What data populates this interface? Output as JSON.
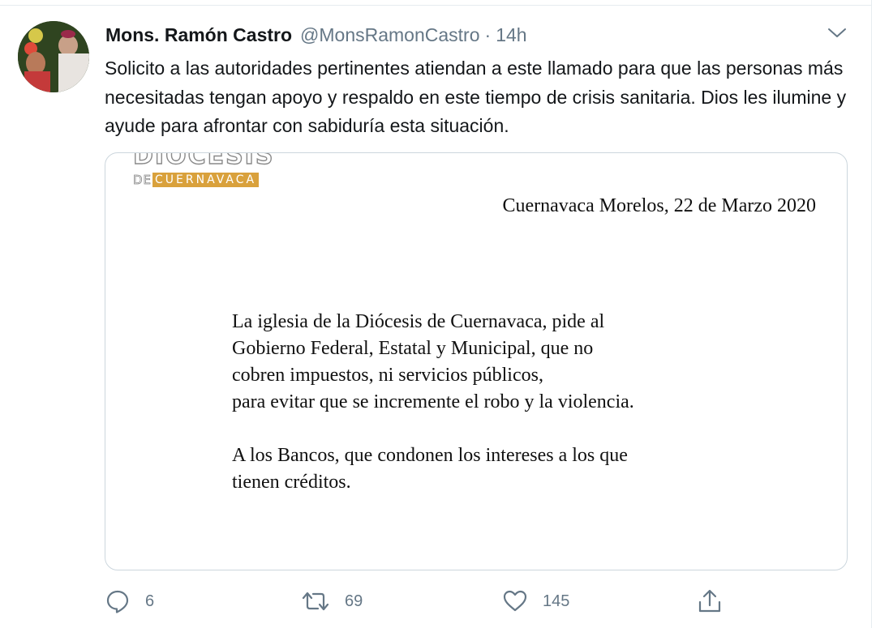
{
  "tweet": {
    "display_name": "Mons. Ramón Castro",
    "handle": "@MonsRamonCastro",
    "separator": "·",
    "time": "14h",
    "text": "Solicito a las autoridades pertinentes atiendan a este llamado para que las personas más necesitadas tengan apoyo y respaldo en este tiempo de crisis sanitaria. Dios les ilumine y ayude para afrontar con sabiduría esta situación."
  },
  "media": {
    "logo_top": "DIÓCESIS",
    "logo_de": "DE",
    "logo_city": "CUERNAVACA",
    "date_line": "Cuernavaca Morelos, 22 de Marzo 2020",
    "paragraph_1": "La iglesia de la Diócesis de Cuernavaca, pide al\nGobierno Federal, Estatal y Municipal, que no\ncobren impuestos, ni servicios públicos,\npara evitar que se incremente el robo y la violencia.",
    "paragraph_2": "A los Bancos, que condonen los intereses a los que\ntienen créditos."
  },
  "actions": {
    "replies": "6",
    "retweets": "69",
    "likes": "145"
  },
  "icons": {
    "more": "chevron-down-icon",
    "reply": "reply-icon",
    "retweet": "retweet-icon",
    "like": "heart-icon",
    "share": "share-icon"
  },
  "colors": {
    "text": "#14171a",
    "secondary": "#657786",
    "border": "#ccd6dd",
    "logo_accent": "#d9a13c"
  }
}
